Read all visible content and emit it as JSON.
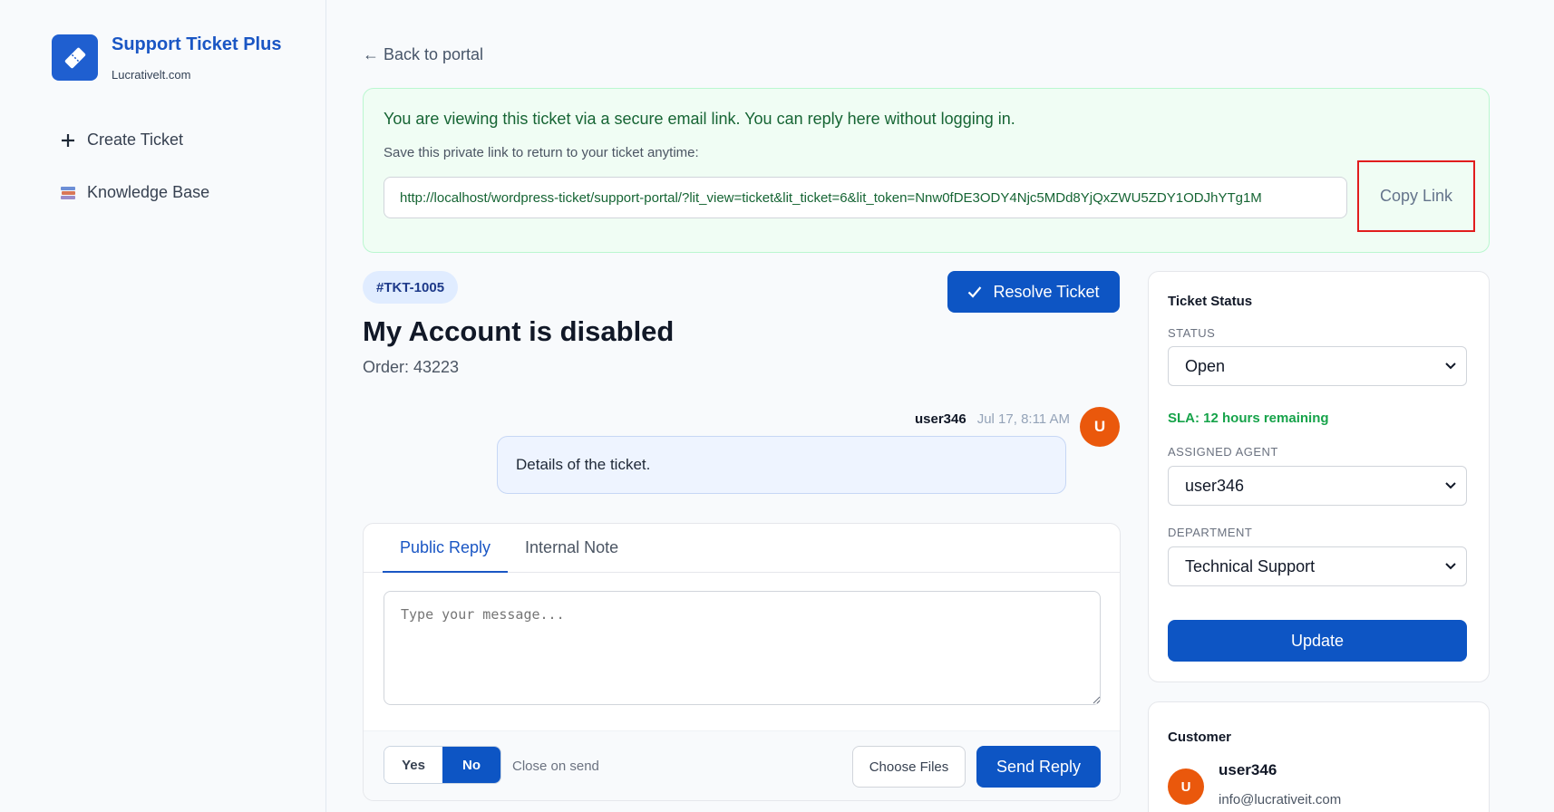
{
  "brand": {
    "title": "Support Ticket Plus",
    "subtitle": "Lucrativelt.com"
  },
  "sidebar": {
    "items": [
      {
        "label": "Create Ticket",
        "icon": "plus-icon"
      },
      {
        "label": "Knowledge Base",
        "icon": "books-icon"
      }
    ]
  },
  "main": {
    "back_link": "← Back to portal",
    "banner": {
      "message": "You are viewing this ticket via a secure email link. You can reply here without logging in.",
      "sub": "Save this private link to return to your ticket anytime:",
      "link": "http://localhost/wordpress-ticket/support-portal/?lit_view=ticket&lit_ticket=6&lit_token=Nnw0fDE3ODY4Njc5MDd8YjQxZWU5ZDY1ODJhYTg1M",
      "copy_label": "Copy Link"
    },
    "ticket": {
      "id": "#TKT-1005",
      "resolve_label": "Resolve Ticket",
      "title": "My Account is disabled",
      "order": "Order: 43223"
    },
    "message": {
      "user": "user346",
      "time": "Jul 17, 8:11 AM",
      "avatar_letter": "U",
      "body": "Details of the ticket."
    },
    "reply": {
      "tabs": [
        "Public Reply",
        "Internal Note"
      ],
      "placeholder": "Type your message...",
      "toggle_yes": "Yes",
      "toggle_no": "No",
      "close_label": "Close on send",
      "files_label": "Choose Files",
      "send_label": "Send Reply"
    }
  },
  "status_panel": {
    "title": "Ticket Status",
    "status_label": "STATUS",
    "status_value": "Open",
    "sla": "SLA: 12 hours remaining",
    "agent_label": "ASSIGNED AGENT",
    "agent_value": "user346",
    "department_label": "DEPARTMENT",
    "department_value": "Technical Support",
    "update_label": "Update"
  },
  "customer": {
    "title": "Customer",
    "avatar_letter": "U",
    "name": "user346",
    "email": "info@lucrativeit.com"
  },
  "colors": {
    "primary": "#0d55c4",
    "success": "#16a34a",
    "avatar": "#ea580c",
    "highlight": "#e11d1d"
  }
}
